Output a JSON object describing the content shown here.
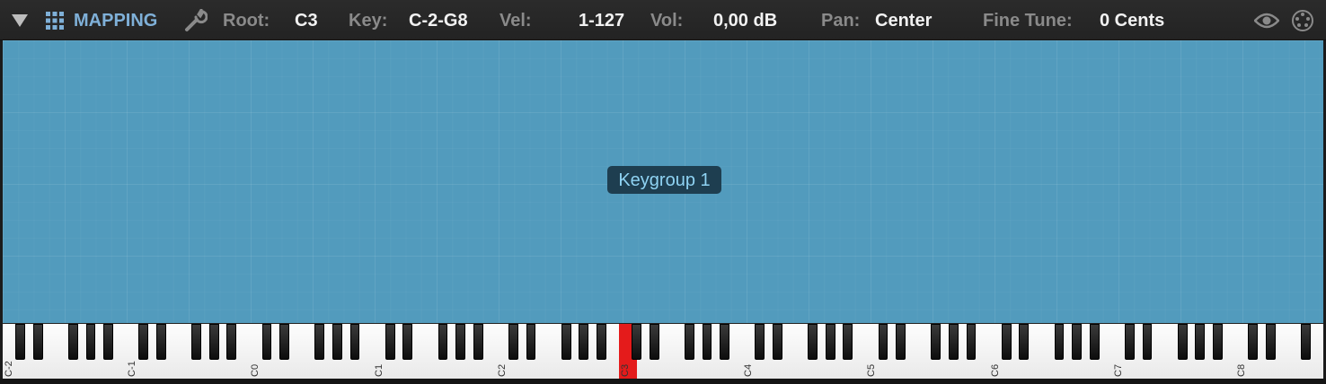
{
  "toolbar": {
    "title": "MAPPING",
    "root_label": "Root:",
    "root_value": "C3",
    "key_label": "Key:",
    "key_value": "C-2-G8",
    "vel_label": "Vel:",
    "vel_value": "1-127",
    "vol_label": "Vol:",
    "vol_value": "0,00 dB",
    "pan_label": "Pan:",
    "pan_value": "Center",
    "fine_label": "Fine Tune:",
    "fine_value": "0 Cents"
  },
  "icons": {
    "collapse": "triangle-down-icon",
    "grid": "grid-icon",
    "wrench": "wrench-icon",
    "eye": "eye-icon",
    "settings": "dial-icon"
  },
  "mapping": {
    "keygroup_label": "Keygroup 1"
  },
  "keyboard": {
    "octave_labels": [
      "C-2",
      "C-1",
      "C0",
      "C1",
      "C2",
      "C3",
      "C4",
      "C5",
      "C6",
      "C7",
      "C8"
    ],
    "active_key": "C3"
  },
  "colors": {
    "map_background": "#529bbd",
    "keygroup_background": "#1e3e50",
    "active_key": "#e41b1b",
    "title_accent": "#7fb0d8"
  }
}
